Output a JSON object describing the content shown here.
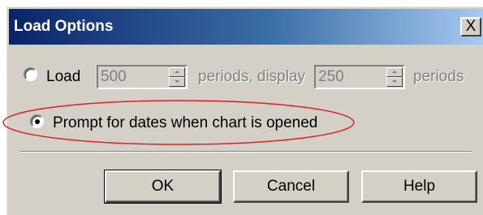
{
  "dialog": {
    "title": "Load Options",
    "close_label": "X"
  },
  "load_option": {
    "selected": false,
    "load_label": "Load",
    "periods_value": "500",
    "periods_display_label": "periods, display",
    "display_value": "250",
    "periods_label": "periods",
    "enabled": false
  },
  "prompt_option": {
    "selected": true,
    "label": "Prompt for dates when chart is opened"
  },
  "buttons": {
    "ok": "OK",
    "cancel": "Cancel",
    "help": "Help"
  },
  "annotation": {
    "shape": "ellipse",
    "color": "#e02020",
    "target": "prompt_option"
  },
  "colors": {
    "title_start": "#0a246a",
    "title_end": "#a6caf0",
    "face": "#d4d0c8"
  }
}
